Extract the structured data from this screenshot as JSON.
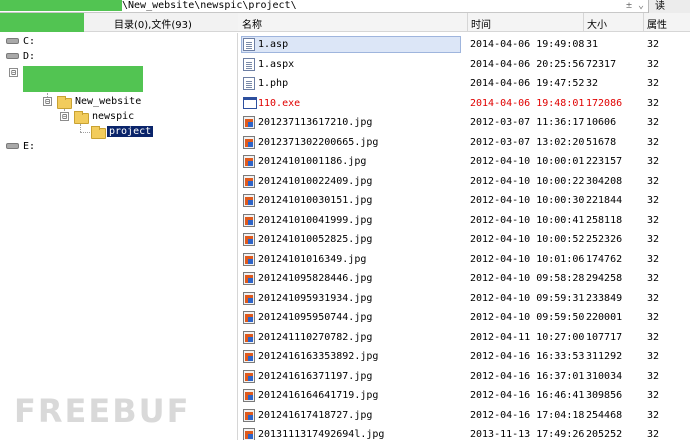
{
  "address_bar": {
    "path_suffix": "\\New_website\\newspic\\project\\",
    "controls": "±  ⌄",
    "button_label": "读"
  },
  "tree_header": {
    "summary": "目录(0),文件(93)"
  },
  "columns": {
    "name": "名称",
    "time": "时间",
    "size": "大小",
    "attr": "属性"
  },
  "tree": {
    "drive_c": "C:",
    "drive_d": "D:",
    "expander_d": "⊟",
    "expander_new_website": "⊟",
    "expander_newspic": "⊟",
    "new_website": "New_website",
    "newspic": "newspic",
    "project": "project",
    "drive_e": "E:"
  },
  "files": [
    {
      "name": "1.asp",
      "time": "2014-04-06 19:49:08",
      "size": "31",
      "attr": "32",
      "icon": "script-icon",
      "selected": true,
      "highlight": false
    },
    {
      "name": "1.aspx",
      "time": "2014-04-06 20:25:56",
      "size": "72317",
      "attr": "32",
      "icon": "document-icon",
      "selected": false,
      "highlight": false
    },
    {
      "name": "1.php",
      "time": "2014-04-06 19:47:52",
      "size": "32",
      "attr": "32",
      "icon": "document-icon",
      "selected": false,
      "highlight": false
    },
    {
      "name": "110.exe",
      "time": "2014-04-06 19:48:01",
      "size": "172086",
      "attr": "32",
      "icon": "application-icon",
      "selected": false,
      "highlight": true
    },
    {
      "name": "201237113617210.jpg",
      "time": "2012-03-07 11:36:17",
      "size": "10606",
      "attr": "32",
      "icon": "image-icon",
      "selected": false,
      "highlight": false
    },
    {
      "name": "2012371302200665.jpg",
      "time": "2012-03-07 13:02:20",
      "size": "51678",
      "attr": "32",
      "icon": "image-icon",
      "selected": false,
      "highlight": false
    },
    {
      "name": "20124101001186.jpg",
      "time": "2012-04-10 10:00:01",
      "size": "223157",
      "attr": "32",
      "icon": "image-icon",
      "selected": false,
      "highlight": false
    },
    {
      "name": "201241010022409.jpg",
      "time": "2012-04-10 10:00:22",
      "size": "304208",
      "attr": "32",
      "icon": "image-icon",
      "selected": false,
      "highlight": false
    },
    {
      "name": "201241010030151.jpg",
      "time": "2012-04-10 10:00:30",
      "size": "221844",
      "attr": "32",
      "icon": "image-icon",
      "selected": false,
      "highlight": false
    },
    {
      "name": "201241010041999.jpg",
      "time": "2012-04-10 10:00:41",
      "size": "258118",
      "attr": "32",
      "icon": "image-icon",
      "selected": false,
      "highlight": false
    },
    {
      "name": "201241010052825.jpg",
      "time": "2012-04-10 10:00:52",
      "size": "252326",
      "attr": "32",
      "icon": "image-icon",
      "selected": false,
      "highlight": false
    },
    {
      "name": "20124101016349.jpg",
      "time": "2012-04-10 10:01:06",
      "size": "174762",
      "attr": "32",
      "icon": "image-icon",
      "selected": false,
      "highlight": false
    },
    {
      "name": "201241095828446.jpg",
      "time": "2012-04-10 09:58:28",
      "size": "294258",
      "attr": "32",
      "icon": "image-icon",
      "selected": false,
      "highlight": false
    },
    {
      "name": "201241095931934.jpg",
      "time": "2012-04-10 09:59:31",
      "size": "233849",
      "attr": "32",
      "icon": "image-icon",
      "selected": false,
      "highlight": false
    },
    {
      "name": "201241095950744.jpg",
      "time": "2012-04-10 09:59:50",
      "size": "220001",
      "attr": "32",
      "icon": "image-icon",
      "selected": false,
      "highlight": false
    },
    {
      "name": "201241110270782.jpg",
      "time": "2012-04-11 10:27:00",
      "size": "107717",
      "attr": "32",
      "icon": "image-icon",
      "selected": false,
      "highlight": false
    },
    {
      "name": "2012416163353892.jpg",
      "time": "2012-04-16 16:33:53",
      "size": "311292",
      "attr": "32",
      "icon": "image-icon",
      "selected": false,
      "highlight": false
    },
    {
      "name": "201241616371197.jpg",
      "time": "2012-04-16 16:37:01",
      "size": "310034",
      "attr": "32",
      "icon": "image-icon",
      "selected": false,
      "highlight": false
    },
    {
      "name": "2012416164641719.jpg",
      "time": "2012-04-16 16:46:41",
      "size": "309856",
      "attr": "32",
      "icon": "image-icon",
      "selected": false,
      "highlight": false
    },
    {
      "name": "201241617418727.jpg",
      "time": "2012-04-16 17:04:18",
      "size": "254468",
      "attr": "32",
      "icon": "image-icon",
      "selected": false,
      "highlight": false
    },
    {
      "name": "2013111317492694l.jpg",
      "time": "2013-11-13 17:49:26",
      "size": "205252",
      "attr": "32",
      "icon": "image-icon",
      "selected": false,
      "highlight": false
    }
  ],
  "watermark": "FREEBUF",
  "colors": {
    "redaction": "#52c452",
    "highlight_text": "#e00000",
    "selection": "#0a246a"
  }
}
